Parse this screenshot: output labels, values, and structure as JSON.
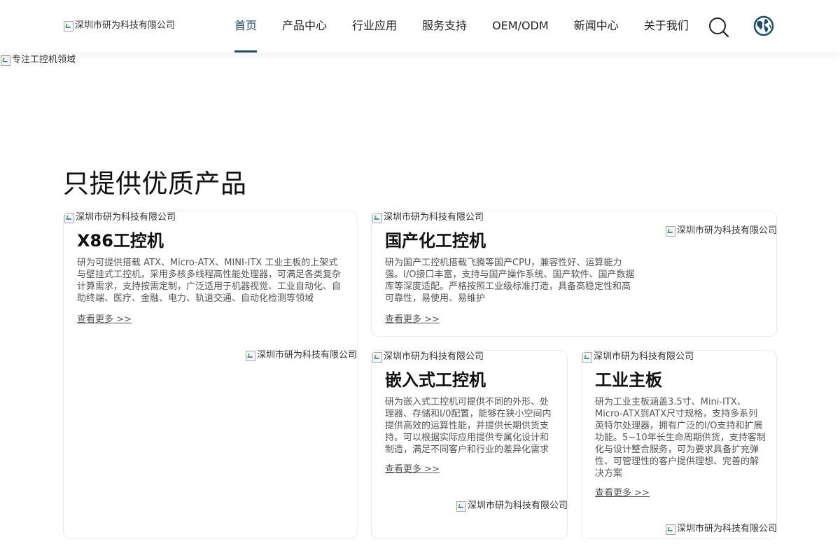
{
  "header": {
    "logo_alt": "深圳市研为科技有限公司",
    "nav": [
      {
        "label": "首页",
        "active": true
      },
      {
        "label": "产品中心"
      },
      {
        "label": "行业应用"
      },
      {
        "label": "服务支持"
      },
      {
        "label": "OEM/ODM"
      },
      {
        "label": "新闻中心"
      },
      {
        "label": "关于我们"
      }
    ],
    "search_icon": "search-icon",
    "globe_icon": "globe-icon",
    "accent_color": "#1c4e6b"
  },
  "banner": {
    "alt": "专注工控机领域"
  },
  "section": {
    "title": "只提供优质产品"
  },
  "products": [
    {
      "img_alt": "深圳市研为科技有限公司",
      "title": "X86工控机",
      "desc": "研为可提供搭载 ATX、Micro-ATX、MINI-ITX 工业主板的上架式与壁挂式工控机，采用多核多线程高性能处理器，可满足各类复杂计算需求，支持按需定制，广泛适用于机器视觉、工业自动化、自助终端、医疗、金融、电力、轨道交通、自动化检测等领域",
      "more": "查看更多 >>",
      "side_img_alt": "深圳市研为科技有限公司"
    },
    {
      "img_alt": "深圳市研为科技有限公司",
      "title": "国产化工控机",
      "desc": "研为国产工控机搭载飞腾等国产CPU，兼容性好、运算能力强。I/O接口丰富，支持与国产操作系统、国产软件、国产数据库等深度适配。严格按照工业级标准打造，具备高稳定性和高可靠性，易使用、易维护",
      "more": "查看更多 >>",
      "side_img_alt": "深圳市研为科技有限公司"
    },
    {
      "img_alt": "深圳市研为科技有限公司",
      "title": "嵌入式工控机",
      "desc": "研为嵌入式工控机可提供不同的外形、处理器、存储和I/0配置，能够在狭小空间内提供高效的运算性能，并提供长期供货支持。可以根据实际应用提供专属化设计和制造，满足不同客户和行业的差异化需求",
      "more": "查看更多 >>",
      "side_img_alt": "深圳市研为科技有限公司"
    },
    {
      "img_alt": "深圳市研为科技有限公司",
      "title": "工业主板",
      "desc": "研为工业主板涵盖3.5寸、Mini-ITX、Micro-ATX到ATX尺寸规格，支持多系列英特尔处理器，拥有广泛的I/O支持和扩展功能。5~10年长生命周期供货，支持客制化与设计整合服务，可为要求具备扩充弹性、可管理性的客户提供理想、完善的解决方案",
      "more": "查看更多 >>",
      "side_img_alt": "深圳市研为科技有限公司"
    }
  ]
}
